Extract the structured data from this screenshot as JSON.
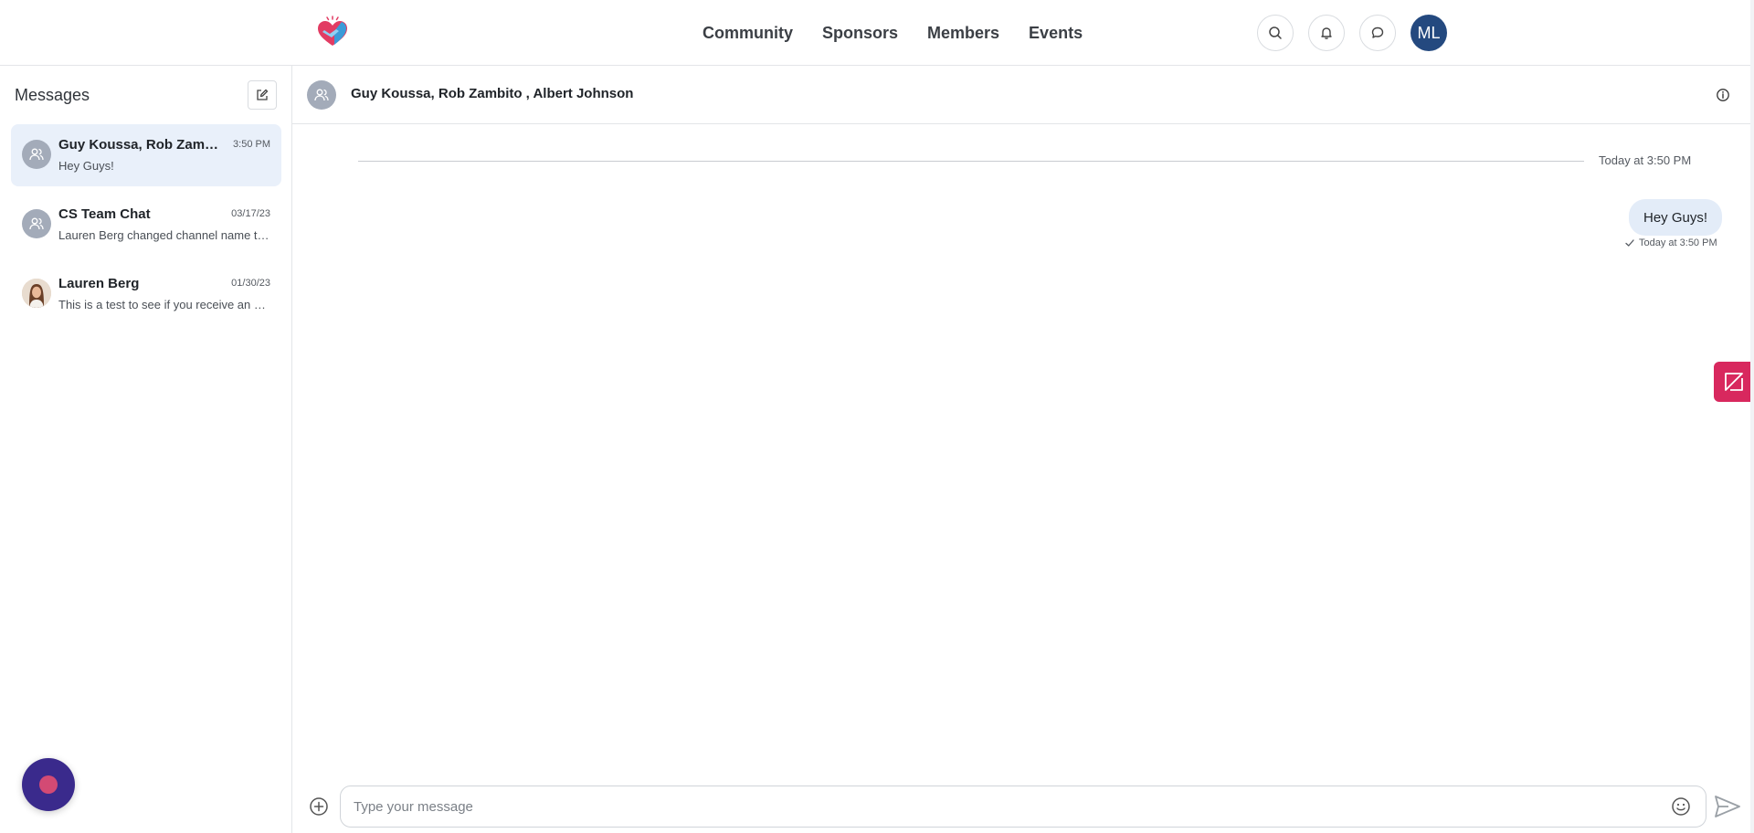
{
  "nav": {
    "links": [
      "Community",
      "Sponsors",
      "Members",
      "Events"
    ],
    "user_initials": "ML"
  },
  "sidebar": {
    "title": "Messages",
    "conversations": [
      {
        "name": "Guy Koussa, Rob Zambito , Albert Johnson",
        "time": "3:50 PM",
        "preview": "Hey Guys!",
        "active": true,
        "avatar": "group-icon"
      },
      {
        "name": "CS Team Chat",
        "time": "03/17/23",
        "preview": "Lauren Berg changed channel name to CS Team Chat",
        "active": false,
        "avatar": "group-icon"
      },
      {
        "name": "Lauren Berg",
        "time": "01/30/23",
        "preview": "This is a test to see if you receive an email notification",
        "active": false,
        "avatar": "user-photo"
      }
    ]
  },
  "chat": {
    "title": "Guy Koussa, Rob Zambito , Albert Johnson",
    "divider_label": "Today at 3:50 PM",
    "messages": [
      {
        "text": "Hey Guys!",
        "meta": "Today at 3:50 PM"
      }
    ],
    "composer_placeholder": "Type your message"
  },
  "colors": {
    "accent": "#24497f",
    "bubble": "#e3ecf8",
    "active_item": "#e9f0fa",
    "side_tab": "#d8285e",
    "fab": "#3a2a8c"
  }
}
